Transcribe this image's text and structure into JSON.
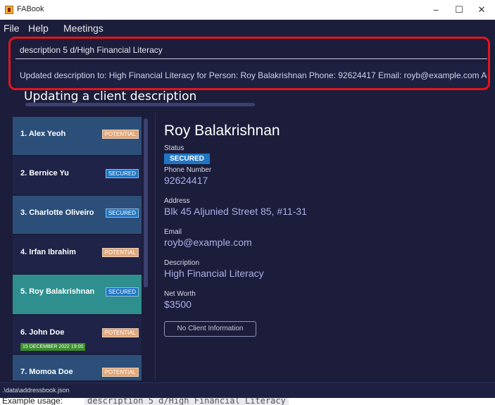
{
  "window": {
    "title": "FABook",
    "controls": {
      "minimize": "–",
      "maximize": "☐",
      "close": "✕"
    }
  },
  "menu": [
    "File",
    "Help",
    "Meetings"
  ],
  "command": {
    "value": "description 5 d/High Financial Literacy"
  },
  "result": {
    "text": "Updated description to: High Financial Literacy for Person: Roy Balakrishnan Phone: 92624417 Email: royb@example.com Address: B"
  },
  "caption": "Updating a client description",
  "persons": [
    {
      "label": "1. Alex Yeoh",
      "status": "POTENTIAL",
      "color": "#2c4f7a"
    },
    {
      "label": "2. Bernice Yu",
      "status": "SECURED",
      "color": "#1f2348"
    },
    {
      "label": "3. Charlotte Oliveiro",
      "status": "SECURED",
      "color": "#2c4f7a"
    },
    {
      "label": "4. Irfan Ibrahim",
      "status": "POTENTIAL",
      "color": "#1f2348"
    },
    {
      "label": "5. Roy Balakrishnan",
      "status": "SECURED",
      "color": "#2f8f8f"
    },
    {
      "label": "6. John Doe",
      "status": "POTENTIAL",
      "color": "#1f2348",
      "meeting": "15 DECEMBER 2022 19:00"
    },
    {
      "label": "7. Momoa Doe",
      "status": "POTENTIAL",
      "color": "#2c4f7a"
    }
  ],
  "detail": {
    "name": "Roy Balakrishnan",
    "status_label": "Status",
    "status": "SECURED",
    "phone_label": "Phone Number",
    "phone": "92624417",
    "address_label": "Address",
    "address": "Blk 45 Aljunied Street 85, #11-31",
    "email_label": "Email",
    "email": "royb@example.com",
    "description_label": "Description",
    "description": "High Financial Literacy",
    "networth_label": "Net Worth",
    "networth": "$3500",
    "no_info_button": "No Client Information"
  },
  "statusbar": {
    "path": ".\\data\\addressbook.json"
  },
  "bottom_note": {
    "text": "Example usage:",
    "code": "description 5 d/High Financial Literacy"
  },
  "colors": {
    "background": "#1b1d3a",
    "secured": "#1f76c4",
    "potential": "#e0a77a",
    "selected_card": "#2f8f8f",
    "highlight_frame": "#e3141b"
  }
}
